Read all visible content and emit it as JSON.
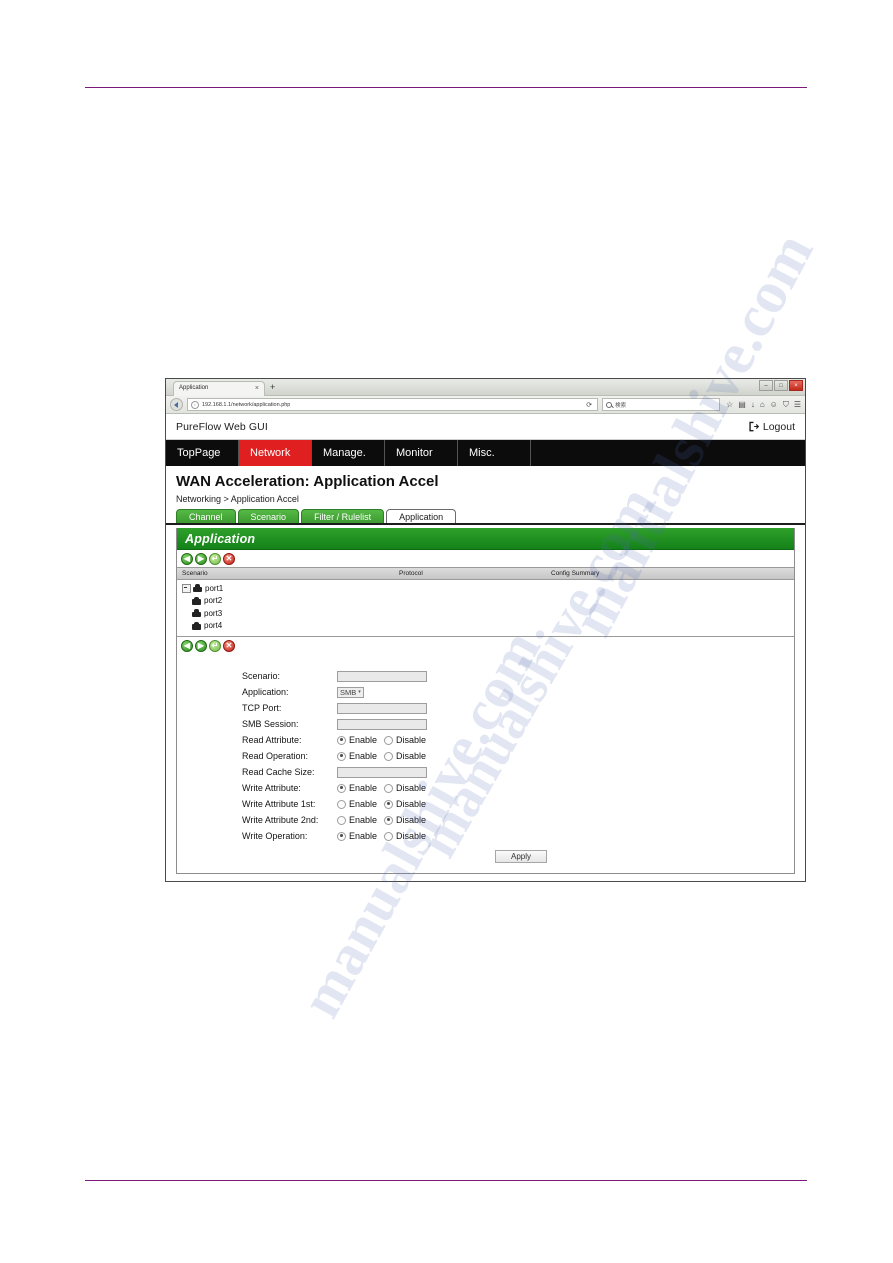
{
  "browser": {
    "tab_title": "Application",
    "tab_close_glyph": "×",
    "new_tab_glyph": "+",
    "url": "192.168.1.1/network/application.php",
    "url_info_glyph": "i",
    "reload_glyph": "⟳",
    "search_placeholder": "検索",
    "toolbar_icons": [
      "☆",
      "▤",
      "↓",
      "⌂",
      "☺",
      "⛉",
      "☰"
    ],
    "window_controls": {
      "minimize": "–",
      "maximize": "□",
      "close": "×"
    }
  },
  "gui": {
    "brand": "PureFlow Web GUI",
    "logout_label": "Logout",
    "nav": [
      {
        "label": "TopPage",
        "active": false
      },
      {
        "label": "Network",
        "active": true
      },
      {
        "label": "Manage.",
        "active": false
      },
      {
        "label": "Monitor",
        "active": false
      },
      {
        "label": "Misc.",
        "active": false
      }
    ],
    "page_title": "WAN Acceleration: Application Accel",
    "breadcrumb": "Networking > Application Accel",
    "subtabs": [
      {
        "label": "Channel",
        "active": false
      },
      {
        "label": "Scenario",
        "active": false
      },
      {
        "label": "Filter / Rulelist",
        "active": false
      },
      {
        "label": "Application",
        "active": true
      }
    ]
  },
  "panel": {
    "title": "Application",
    "toolbar": [
      {
        "name": "previous-button",
        "glyph": "◀",
        "style": "c-green"
      },
      {
        "name": "next-button",
        "glyph": "▶",
        "style": "c-green"
      },
      {
        "name": "apply-change-button",
        "glyph": "↵",
        "style": "c-lgreen"
      },
      {
        "name": "delete-button",
        "glyph": "✕",
        "style": "c-red"
      }
    ],
    "columns": [
      "Scenario",
      "Protocol",
      "Config Summary"
    ],
    "rows": [
      {
        "label": "port1",
        "expandable": true,
        "child": false
      },
      {
        "label": "port2",
        "expandable": false,
        "child": true
      },
      {
        "label": "port3",
        "expandable": false,
        "child": true
      },
      {
        "label": "port4",
        "expandable": false,
        "child": true
      }
    ]
  },
  "form": {
    "fields": [
      {
        "label": "Scenario:",
        "type": "text",
        "value": ""
      },
      {
        "label": "Application:",
        "type": "select",
        "value": "SMB",
        "caret": "▾"
      },
      {
        "label": "TCP Port:",
        "type": "text",
        "value": ""
      },
      {
        "label": "SMB Session:",
        "type": "text",
        "value": ""
      },
      {
        "label": "Read Attribute:",
        "type": "radio",
        "selected": "Enable"
      },
      {
        "label": "Read Operation:",
        "type": "radio",
        "selected": "Enable"
      },
      {
        "label": "Read Cache Size:",
        "type": "text",
        "value": ""
      },
      {
        "label": "Write Attribute:",
        "type": "radio",
        "selected": "Enable"
      },
      {
        "label": "Write Attribute 1st:",
        "type": "radio",
        "selected": "Disable"
      },
      {
        "label": "Write Attribute 2nd:",
        "type": "radio",
        "selected": "Disable"
      },
      {
        "label": "Write Operation:",
        "type": "radio",
        "selected": "Enable"
      }
    ],
    "radio_options": [
      "Enable",
      "Disable"
    ],
    "apply_label": "Apply"
  },
  "watermark": {
    "lines": [
      "manualshive.com",
      "manualshive.com",
      "manualshive.com"
    ]
  },
  "colors": {
    "nav_active": "#e02020",
    "panel_header": "#14821a",
    "tab_green": "#3d9b30",
    "rule": "#7b1a7b"
  }
}
